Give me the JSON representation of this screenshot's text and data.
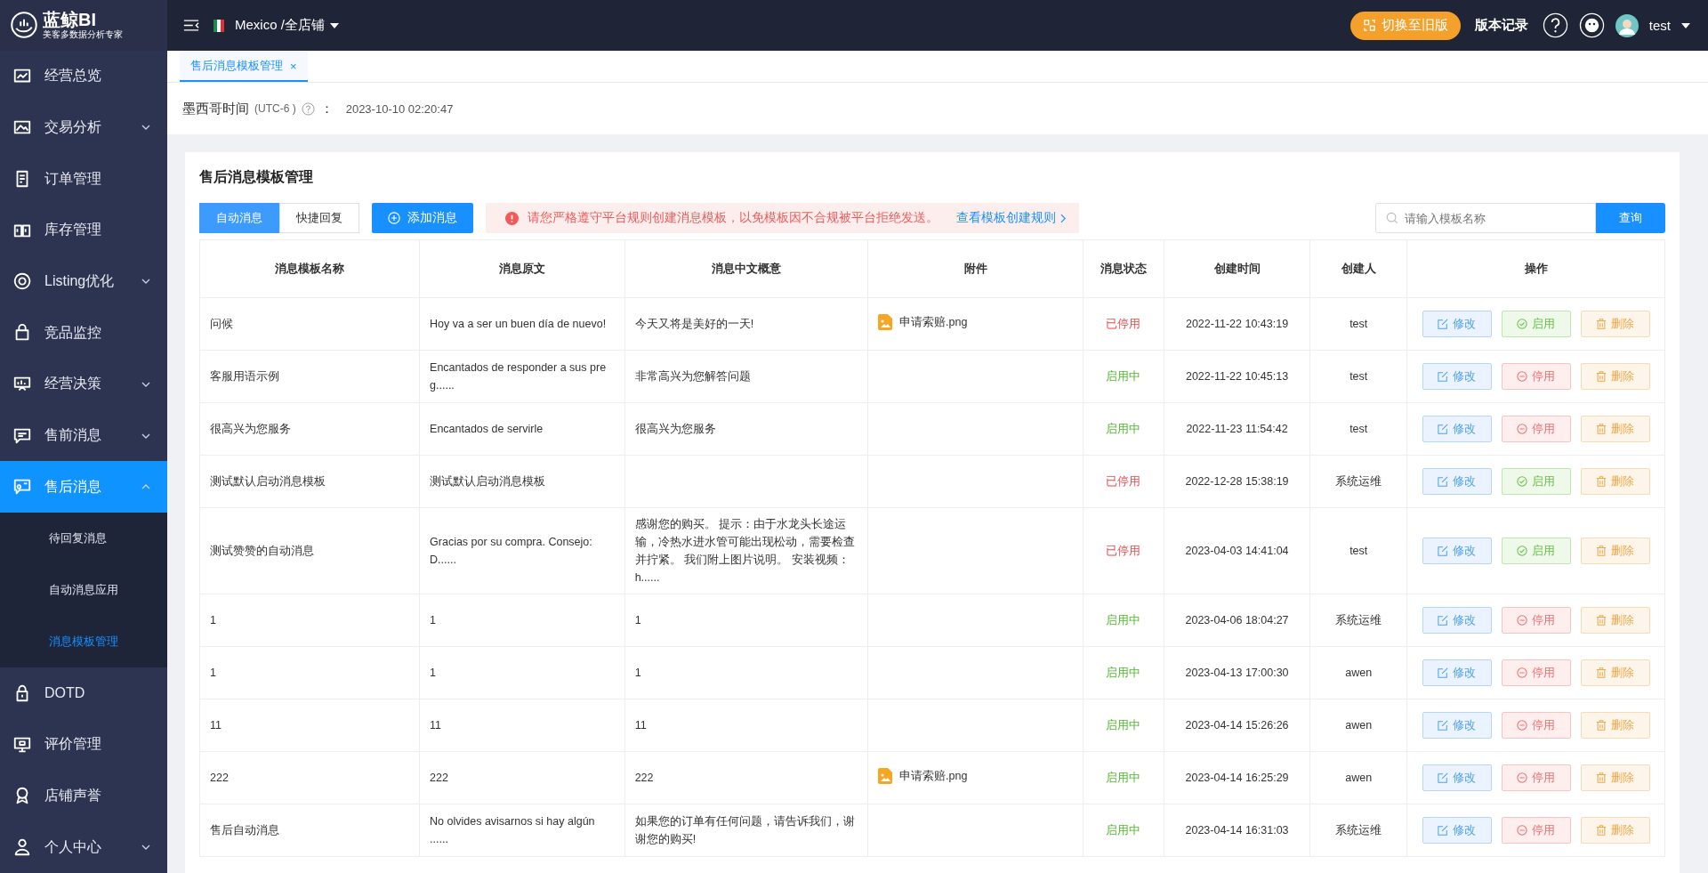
{
  "brand": {
    "name": "蓝鲸BI",
    "tagline": "美客多数据分析专家"
  },
  "sidebar": {
    "items": [
      {
        "label": "经营总览",
        "kind": "link",
        "selected": false
      },
      {
        "label": "交易分析",
        "kind": "group",
        "expanded": false,
        "selected": false
      },
      {
        "label": "订单管理",
        "kind": "link",
        "selected": false
      },
      {
        "label": "库存管理",
        "kind": "link",
        "selected": false
      },
      {
        "label": "Listing优化",
        "kind": "group",
        "expanded": false,
        "selected": false
      },
      {
        "label": "竞品监控",
        "kind": "link",
        "selected": false
      },
      {
        "label": "经营决策",
        "kind": "group",
        "expanded": false,
        "selected": false
      },
      {
        "label": "售前消息",
        "kind": "group",
        "expanded": false,
        "selected": false
      },
      {
        "label": "售后消息",
        "kind": "group",
        "expanded": true,
        "selected": true,
        "children": [
          {
            "label": "待回复消息",
            "selected": false
          },
          {
            "label": "自动消息应用",
            "selected": false
          },
          {
            "label": "消息模板管理",
            "selected": true
          }
        ]
      },
      {
        "label": "DOTD",
        "kind": "link",
        "selected": false
      },
      {
        "label": "评价管理",
        "kind": "link",
        "selected": false
      },
      {
        "label": "店铺声誉",
        "kind": "link",
        "selected": false
      },
      {
        "label": "个人中心",
        "kind": "group",
        "expanded": false,
        "selected": false
      }
    ]
  },
  "topbar": {
    "store": "Mexico /全店铺",
    "switch_button": "切换至旧版",
    "changelog": "版本记录",
    "user": "test"
  },
  "tabs": [
    {
      "label": "售后消息模板管理",
      "selected": true,
      "close": "×"
    }
  ],
  "time": {
    "label": "墨西哥时间",
    "zone": "(UTC-6 )",
    "sep": "：",
    "value": "2023-10-10 02:20:47"
  },
  "card": {
    "title": "售后消息模板管理",
    "modes": [
      {
        "label": "自动消息",
        "selected": true
      },
      {
        "label": "快捷回复",
        "selected": false
      }
    ],
    "add_button": "添加消息",
    "notice": {
      "text": "请您严格遵守平台规则创建消息模板，以免模板因不合规被平台拒绝发送。",
      "link": "查看模板创建规则"
    },
    "search": {
      "placeholder": "请输入模板名称",
      "button": "查询"
    },
    "table": {
      "columns": [
        "消息模板名称",
        "消息原文",
        "消息中文概意",
        "附件",
        "消息状态",
        "创建时间",
        "创建人",
        "操作"
      ],
      "rows": [
        {
          "name": "问候",
          "original": "Hoy va a ser un buen día de nuevo!",
          "summary": "今天又将是美好的一天!",
          "attachment": "申请索赔.png",
          "status": {
            "text": "已停用",
            "kind": "stopped"
          },
          "created": "2022-11-22 10:43:19",
          "creator": "test",
          "actions": [
            {
              "label": "修改",
              "kind": "edit"
            },
            {
              "label": "启用",
              "kind": "enable"
            },
            {
              "label": "删除",
              "kind": "delete"
            }
          ]
        },
        {
          "name": "客服用语示例",
          "original": "Encantados de responder a sus preg......",
          "summary": "非常高兴为您解答问题",
          "status": {
            "text": "启用中",
            "kind": "active"
          },
          "created": "2022-11-22 10:45:13",
          "creator": "test",
          "actions": [
            {
              "label": "修改",
              "kind": "edit"
            },
            {
              "label": "停用",
              "kind": "disable"
            },
            {
              "label": "删除",
              "kind": "delete"
            }
          ]
        },
        {
          "name": "很高兴为您服务",
          "original": "Encantados de servirle",
          "summary": "很高兴为您服务",
          "status": {
            "text": "启用中",
            "kind": "active"
          },
          "created": "2022-11-23 11:54:42",
          "creator": "test",
          "actions": [
            {
              "label": "修改",
              "kind": "edit"
            },
            {
              "label": "停用",
              "kind": "disable"
            },
            {
              "label": "删除",
              "kind": "delete"
            }
          ]
        },
        {
          "name": "测试默认启动消息模板",
          "original": "测试默认启动消息模板",
          "status": {
            "text": "已停用",
            "kind": "stopped"
          },
          "created": "2022-12-28 15:38:19",
          "creator": "系统运维",
          "actions": [
            {
              "label": "修改",
              "kind": "edit"
            },
            {
              "label": "启用",
              "kind": "enable"
            },
            {
              "label": "删除",
              "kind": "delete"
            }
          ]
        },
        {
          "name": "测试赞赞的自动消息",
          "original": "Gracias por su compra. Consejo: D......",
          "summary": "感谢您的购买。 提示：由于水龙头长途运输，冷热水进水管可能出现松动，需要检查并拧紧。 我们附上图片说明。 安装视频：h......",
          "status": {
            "text": "已停用",
            "kind": "stopped"
          },
          "created": "2023-04-03 14:41:04",
          "creator": "test",
          "actions": [
            {
              "label": "修改",
              "kind": "edit"
            },
            {
              "label": "启用",
              "kind": "enable"
            },
            {
              "label": "删除",
              "kind": "delete"
            }
          ]
        },
        {
          "name": "1",
          "original": "1",
          "summary": "1",
          "status": {
            "text": "启用中",
            "kind": "active"
          },
          "created": "2023-04-06 18:04:27",
          "creator": "系统运维",
          "actions": [
            {
              "label": "修改",
              "kind": "edit"
            },
            {
              "label": "停用",
              "kind": "disable"
            },
            {
              "label": "删除",
              "kind": "delete"
            }
          ]
        },
        {
          "name": "1",
          "original": "1",
          "summary": "1",
          "status": {
            "text": "启用中",
            "kind": "active"
          },
          "created": "2023-04-13 17:00:30",
          "creator": "awen",
          "actions": [
            {
              "label": "修改",
              "kind": "edit"
            },
            {
              "label": "停用",
              "kind": "disable"
            },
            {
              "label": "删除",
              "kind": "delete"
            }
          ]
        },
        {
          "name": "11",
          "original": "11",
          "summary": "11",
          "status": {
            "text": "启用中",
            "kind": "active"
          },
          "created": "2023-04-14 15:26:26",
          "creator": "awen",
          "actions": [
            {
              "label": "修改",
              "kind": "edit"
            },
            {
              "label": "停用",
              "kind": "disable"
            },
            {
              "label": "删除",
              "kind": "delete"
            }
          ]
        },
        {
          "name": "222",
          "original": "222",
          "summary": "222",
          "attachment": "申请索赔.png",
          "status": {
            "text": "启用中",
            "kind": "active"
          },
          "created": "2023-04-14 16:25:29",
          "creator": "awen",
          "actions": [
            {
              "label": "修改",
              "kind": "edit"
            },
            {
              "label": "停用",
              "kind": "disable"
            },
            {
              "label": "删除",
              "kind": "delete"
            }
          ]
        },
        {
          "name": "售后自动消息",
          "original": "No olvides avisarnos si hay algún ......",
          "summary": "如果您的订单有任何问题，请告诉我们，谢谢您的购买!",
          "status": {
            "text": "启用中",
            "kind": "active"
          },
          "created": "2023-04-14 16:31:03",
          "creator": "系统运维",
          "actions": [
            {
              "label": "修改",
              "kind": "edit"
            },
            {
              "label": "停用",
              "kind": "disable"
            },
            {
              "label": "删除",
              "kind": "delete"
            }
          ]
        }
      ]
    }
  }
}
